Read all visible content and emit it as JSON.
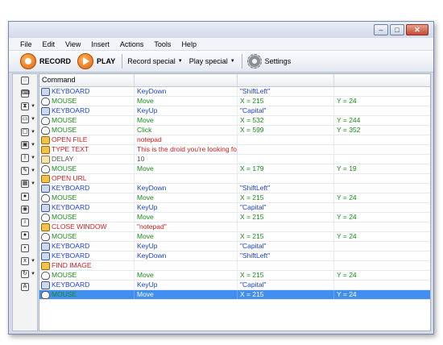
{
  "menu": [
    "File",
    "Edit",
    "View",
    "Insert",
    "Actions",
    "Tools",
    "Help"
  ],
  "toolbar": {
    "record": "RECORD",
    "play": "PLAY",
    "record_special": "Record special",
    "play_special": "Play special",
    "settings": "Settings"
  },
  "window_buttons": [
    "minimize",
    "maximize",
    "close"
  ],
  "colors": {
    "keyboard": "#1a3fd1",
    "mouse": "#1a8a1a",
    "special": "#cc2020",
    "delay": "#666666",
    "selected": "#3f8ef0"
  },
  "grid": {
    "header": "Command",
    "rows": [
      {
        "cmd": "KEYBOARD",
        "a": "KeyDown",
        "b": "\"ShiftLeft\"",
        "c": "",
        "kind": "keyboard"
      },
      {
        "cmd": "MOUSE",
        "a": "Move",
        "b": "X = 215",
        "c": "Y = 24",
        "kind": "mouse"
      },
      {
        "cmd": "KEYBOARD",
        "a": "KeyUp",
        "b": "\"Capital\"",
        "c": "",
        "kind": "keyboard"
      },
      {
        "cmd": "MOUSE",
        "a": "Move",
        "b": "X = 532",
        "c": "Y = 244",
        "kind": "mouse"
      },
      {
        "cmd": "MOUSE",
        "a": "Click",
        "b": "X = 599",
        "c": "Y = 352",
        "kind": "mouse"
      },
      {
        "cmd": "OPEN FILE",
        "a": "notepad",
        "b": "",
        "c": "",
        "kind": "special"
      },
      {
        "cmd": "TYPE TEXT",
        "a": "This is the droid you're looking for!",
        "b": "",
        "c": "",
        "kind": "special"
      },
      {
        "cmd": "DELAY",
        "a": "10",
        "b": "",
        "c": "",
        "kind": "delay"
      },
      {
        "cmd": "MOUSE",
        "a": "Move",
        "b": "X = 179",
        "c": "Y = 19",
        "kind": "mouse"
      },
      {
        "cmd": "OPEN URL",
        "a": "",
        "b": "",
        "c": "",
        "kind": "special"
      },
      {
        "cmd": "KEYBOARD",
        "a": "KeyDown",
        "b": "\"ShiftLeft\"",
        "c": "",
        "kind": "keyboard"
      },
      {
        "cmd": "MOUSE",
        "a": "Move",
        "b": "X = 215",
        "c": "Y = 24",
        "kind": "mouse"
      },
      {
        "cmd": "KEYBOARD",
        "a": "KeyUp",
        "b": "\"Capital\"",
        "c": "",
        "kind": "keyboard"
      },
      {
        "cmd": "MOUSE",
        "a": "Move",
        "b": "X = 215",
        "c": "Y = 24",
        "kind": "mouse"
      },
      {
        "cmd": "CLOSE WINDOW",
        "a": "\"notepad\"",
        "b": "",
        "c": "",
        "kind": "special"
      },
      {
        "cmd": "MOUSE",
        "a": "Move",
        "b": "X = 215",
        "c": "Y = 24",
        "kind": "mouse"
      },
      {
        "cmd": "KEYBOARD",
        "a": "KeyUp",
        "b": "\"Capital\"",
        "c": "",
        "kind": "keyboard"
      },
      {
        "cmd": "KEYBOARD",
        "a": "KeyDown",
        "b": "\"ShiftLeft\"",
        "c": "",
        "kind": "keyboard"
      },
      {
        "cmd": "FIND IMAGE",
        "a": "",
        "b": "",
        "c": "",
        "kind": "special"
      },
      {
        "cmd": "MOUSE",
        "a": "Move",
        "b": "X = 215",
        "c": "Y = 24",
        "kind": "mouse"
      },
      {
        "cmd": "KEYBOARD",
        "a": "KeyUp",
        "b": "\"Capital\"",
        "c": "",
        "kind": "keyboard"
      },
      {
        "cmd": "MOUSE",
        "a": "Move",
        "b": "X = 215",
        "c": "Y = 24",
        "kind": "mouse",
        "selected": true
      }
    ]
  },
  "sidebar_icons": [
    "mouse-icon",
    "keyboard-icon",
    "delay-icon",
    "open-file-icon",
    "window-icon",
    "window-group-icon",
    "text-icon",
    "pencil-icon",
    "image-icon",
    "stop-icon",
    "web-icon",
    "info-icon",
    "globe-icon",
    "run-icon",
    "variable-icon",
    "loop-icon",
    "font-icon"
  ]
}
